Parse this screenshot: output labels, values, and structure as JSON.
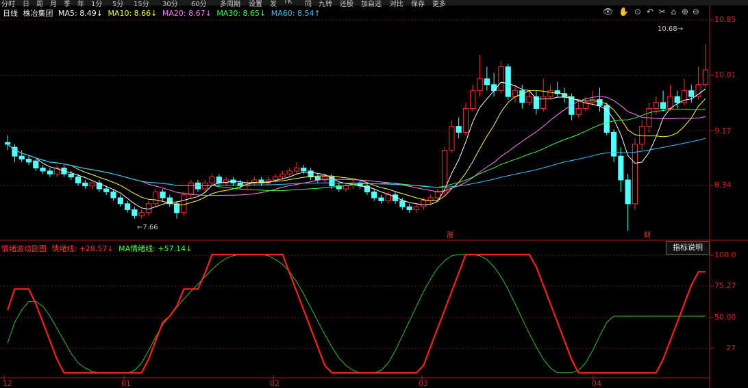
{
  "toolbar": {
    "items": [
      "分时",
      "日",
      "周",
      "月",
      "季",
      "年",
      "1分",
      "5分",
      "15分",
      "30分",
      "60分",
      "多周期",
      "设置",
      "发",
      "TK",
      "同",
      "九转",
      "还股",
      "加自选",
      "对比",
      "保存",
      "更多"
    ]
  },
  "main_legend": {
    "period": "日线",
    "name": "株冶集团",
    "ma5": "MA5: 8.49↓",
    "ma10": "MA10: 8.66↓",
    "ma20": "MA20: 8.67↓",
    "ma30": "MA30: 8.65↓",
    "ma60": "MA60: 8.54↑"
  },
  "sub_legend": {
    "title": "情绪波动副图",
    "line1": "情绪线: +28.57↓",
    "line2": "MA情绪线: +57.14↓"
  },
  "indicator_button": "指标说明",
  "price_axis": [
    "10.85",
    "10.01",
    "9.17",
    "8.34"
  ],
  "sub_axis": [
    "100.0",
    "75.27",
    "50.00",
    "27"
  ],
  "date_axis": [
    "12",
    "01",
    "02",
    "03",
    "04"
  ],
  "annotations": {
    "low": "←7.66",
    "high": "10.68→",
    "zhang": "涨",
    "cai": "财"
  },
  "colors": {
    "up": "#ff3030",
    "down": "#54ffff",
    "ma5": "#ffffff",
    "ma10": "#ffff40",
    "ma20": "#ff80ff",
    "ma30": "#40ff40",
    "ma60": "#40c0ff"
  },
  "icons": [
    "eye-icon",
    "hand-icon",
    "play-icon",
    "scissors-icon",
    "lock-icon",
    "zoom-in-icon",
    "zoom-out-icon"
  ],
  "chart_data": {
    "type": "candlestick",
    "price_range": [
      7.4,
      11.1
    ],
    "sub_range": [
      0,
      100
    ],
    "candles": [
      [
        9.03,
        9.0,
        9.15,
        8.9
      ],
      [
        8.95,
        8.8,
        9.0,
        8.7
      ],
      [
        8.8,
        8.75,
        8.9,
        8.7
      ],
      [
        8.75,
        8.7,
        8.8,
        8.65
      ],
      [
        8.72,
        8.6,
        8.75,
        8.55
      ],
      [
        8.6,
        8.55,
        8.65,
        8.5
      ],
      [
        8.55,
        8.5,
        8.6,
        8.45
      ],
      [
        8.5,
        8.6,
        8.65,
        8.45
      ],
      [
        8.6,
        8.5,
        8.65,
        8.45
      ],
      [
        8.5,
        8.45,
        8.55,
        8.4
      ],
      [
        8.45,
        8.35,
        8.5,
        8.3
      ],
      [
        8.35,
        8.3,
        8.4,
        8.25
      ],
      [
        8.3,
        8.35,
        8.4,
        8.25
      ],
      [
        8.35,
        8.25,
        8.4,
        8.2
      ],
      [
        8.25,
        8.2,
        8.3,
        8.15
      ],
      [
        8.2,
        8.1,
        8.25,
        8.05
      ],
      [
        8.1,
        8.0,
        8.15,
        7.95
      ],
      [
        8.0,
        7.9,
        8.05,
        7.85
      ],
      [
        7.9,
        7.8,
        7.95,
        7.75
      ],
      [
        7.8,
        7.85,
        7.9,
        7.75
      ],
      [
        7.85,
        8.0,
        8.05,
        7.8
      ],
      [
        8.0,
        8.2,
        8.25,
        7.95
      ],
      [
        8.2,
        8.1,
        8.25,
        8.05
      ],
      [
        8.1,
        8.0,
        8.15,
        7.95
      ],
      [
        8.0,
        7.85,
        8.05,
        7.75
      ],
      [
        7.85,
        8.15,
        8.2,
        7.8
      ],
      [
        8.15,
        8.35,
        8.4,
        8.1
      ],
      [
        8.35,
        8.25,
        8.4,
        8.2
      ],
      [
        8.25,
        8.35,
        8.4,
        8.2
      ],
      [
        8.35,
        8.45,
        8.5,
        8.3
      ],
      [
        8.45,
        8.35,
        8.5,
        8.3
      ],
      [
        8.35,
        8.4,
        8.45,
        8.3
      ],
      [
        8.4,
        8.35,
        8.45,
        8.3
      ],
      [
        8.35,
        8.3,
        8.4,
        8.25
      ],
      [
        8.3,
        8.35,
        8.4,
        8.25
      ],
      [
        8.35,
        8.4,
        8.45,
        8.3
      ],
      [
        8.4,
        8.35,
        8.45,
        8.3
      ],
      [
        8.35,
        8.4,
        8.45,
        8.3
      ],
      [
        8.4,
        8.45,
        8.5,
        8.35
      ],
      [
        8.45,
        8.5,
        8.55,
        8.4
      ],
      [
        8.5,
        8.55,
        8.6,
        8.45
      ],
      [
        8.55,
        8.6,
        8.7,
        8.5
      ],
      [
        8.6,
        8.55,
        8.65,
        8.5
      ],
      [
        8.55,
        8.45,
        8.6,
        8.4
      ],
      [
        8.45,
        8.4,
        8.5,
        8.35
      ],
      [
        8.4,
        8.45,
        8.5,
        8.35
      ],
      [
        8.45,
        8.3,
        8.5,
        8.25
      ],
      [
        8.3,
        8.25,
        8.35,
        8.2
      ],
      [
        8.25,
        8.3,
        8.35,
        8.2
      ],
      [
        8.3,
        8.35,
        8.4,
        8.25
      ],
      [
        8.35,
        8.3,
        8.4,
        8.25
      ],
      [
        8.3,
        8.2,
        8.35,
        8.15
      ],
      [
        8.2,
        8.1,
        8.25,
        8.05
      ],
      [
        8.1,
        8.05,
        8.15,
        8.0
      ],
      [
        8.05,
        8.15,
        8.2,
        8.0
      ],
      [
        8.15,
        8.05,
        8.2,
        8.0
      ],
      [
        8.05,
        7.95,
        8.1,
        7.9
      ],
      [
        7.95,
        7.9,
        8.0,
        7.85
      ],
      [
        7.9,
        7.95,
        8.0,
        7.85
      ],
      [
        7.95,
        8.05,
        8.1,
        7.9
      ],
      [
        8.05,
        8.1,
        8.15,
        8.0
      ],
      [
        8.1,
        8.2,
        8.25,
        8.05
      ],
      [
        8.2,
        8.9,
        8.95,
        8.15
      ],
      [
        8.9,
        9.3,
        9.4,
        8.85
      ],
      [
        9.3,
        9.2,
        9.45,
        9.1
      ],
      [
        9.2,
        9.6,
        9.7,
        9.15
      ],
      [
        9.6,
        9.9,
        10.0,
        9.55
      ],
      [
        9.9,
        10.1,
        10.5,
        9.8
      ],
      [
        10.1,
        10.0,
        10.3,
        9.9
      ],
      [
        10.0,
        9.9,
        10.2,
        9.8
      ],
      [
        9.9,
        10.3,
        10.4,
        9.85
      ],
      [
        10.3,
        9.8,
        10.35,
        9.75
      ],
      [
        9.8,
        9.9,
        10.0,
        9.7
      ],
      [
        9.9,
        9.7,
        10.0,
        9.6
      ],
      [
        9.7,
        9.8,
        9.9,
        9.65
      ],
      [
        9.8,
        9.6,
        9.9,
        9.5
      ],
      [
        9.6,
        9.8,
        10.1,
        9.55
      ],
      [
        9.8,
        9.9,
        10.0,
        9.75
      ],
      [
        9.9,
        9.85,
        10.05,
        9.8
      ],
      [
        9.85,
        9.8,
        9.95,
        9.7
      ],
      [
        9.8,
        9.5,
        9.85,
        9.4
      ],
      [
        9.5,
        9.6,
        9.7,
        9.45
      ],
      [
        9.6,
        9.7,
        9.8,
        9.55
      ],
      [
        9.7,
        9.75,
        9.9,
        9.65
      ],
      [
        9.75,
        9.65,
        9.95,
        9.55
      ],
      [
        9.65,
        9.2,
        9.7,
        9.15
      ],
      [
        9.2,
        8.8,
        9.25,
        8.7
      ],
      [
        8.8,
        8.4,
        8.95,
        8.2
      ],
      [
        8.4,
        8.0,
        8.5,
        7.55
      ],
      [
        8.0,
        9.0,
        9.1,
        7.9
      ],
      [
        9.0,
        9.3,
        9.4,
        8.9
      ],
      [
        9.3,
        9.6,
        9.7,
        9.2
      ],
      [
        9.6,
        9.7,
        9.8,
        9.5
      ],
      [
        9.7,
        9.6,
        9.9,
        9.55
      ],
      [
        9.6,
        9.8,
        10.0,
        9.55
      ],
      [
        9.8,
        9.7,
        9.9,
        9.6
      ],
      [
        9.7,
        9.9,
        10.1,
        9.65
      ],
      [
        9.9,
        9.8,
        10.0,
        9.7
      ],
      [
        9.8,
        10.0,
        10.3,
        9.75
      ],
      [
        10.0,
        10.25,
        10.68,
        9.95
      ]
    ],
    "ma_lines": [
      "ma5",
      "ma10",
      "ma20",
      "ma30",
      "ma60"
    ],
    "emotion_line": [
      55,
      72,
      72,
      72,
      60,
      45,
      30,
      15,
      4,
      4,
      4,
      4,
      4,
      4,
      4,
      4,
      4,
      4,
      4,
      4,
      15,
      30,
      45,
      50,
      58,
      72,
      72,
      72,
      85,
      100,
      100,
      100,
      100,
      100,
      100,
      100,
      100,
      100,
      100,
      100,
      85,
      70,
      55,
      40,
      25,
      10,
      4,
      4,
      4,
      4,
      4,
      4,
      4,
      4,
      4,
      4,
      4,
      4,
      4,
      10,
      25,
      40,
      55,
      70,
      85,
      100,
      100,
      100,
      100,
      100,
      100,
      100,
      100,
      100,
      100,
      90,
      75,
      60,
      45,
      30,
      15,
      4,
      4,
      4,
      4,
      4,
      4,
      4,
      4,
      4,
      4,
      4,
      4,
      15,
      30,
      45,
      60,
      75,
      86,
      86
    ],
    "ma_emotion_line": [
      28,
      45,
      55,
      62,
      62,
      58,
      50,
      40,
      30,
      20,
      12,
      8,
      5,
      4,
      4,
      4,
      4,
      4,
      6,
      12,
      22,
      33,
      43,
      50,
      57,
      64,
      70,
      76,
      82,
      88,
      93,
      97,
      99,
      100,
      100,
      100,
      100,
      99,
      96,
      92,
      86,
      78,
      68,
      57,
      46,
      35,
      25,
      16,
      10,
      6,
      4,
      4,
      4,
      6,
      12,
      22,
      34,
      46,
      58,
      70,
      80,
      89,
      95,
      99,
      100,
      100,
      100,
      99,
      96,
      90,
      82,
      72,
      60,
      48,
      36,
      25,
      15,
      8,
      4,
      4,
      4,
      6,
      12,
      22,
      34,
      45,
      50,
      50,
      50,
      50,
      50,
      50,
      50,
      50,
      50,
      50,
      50,
      50,
      50,
      50
    ]
  }
}
